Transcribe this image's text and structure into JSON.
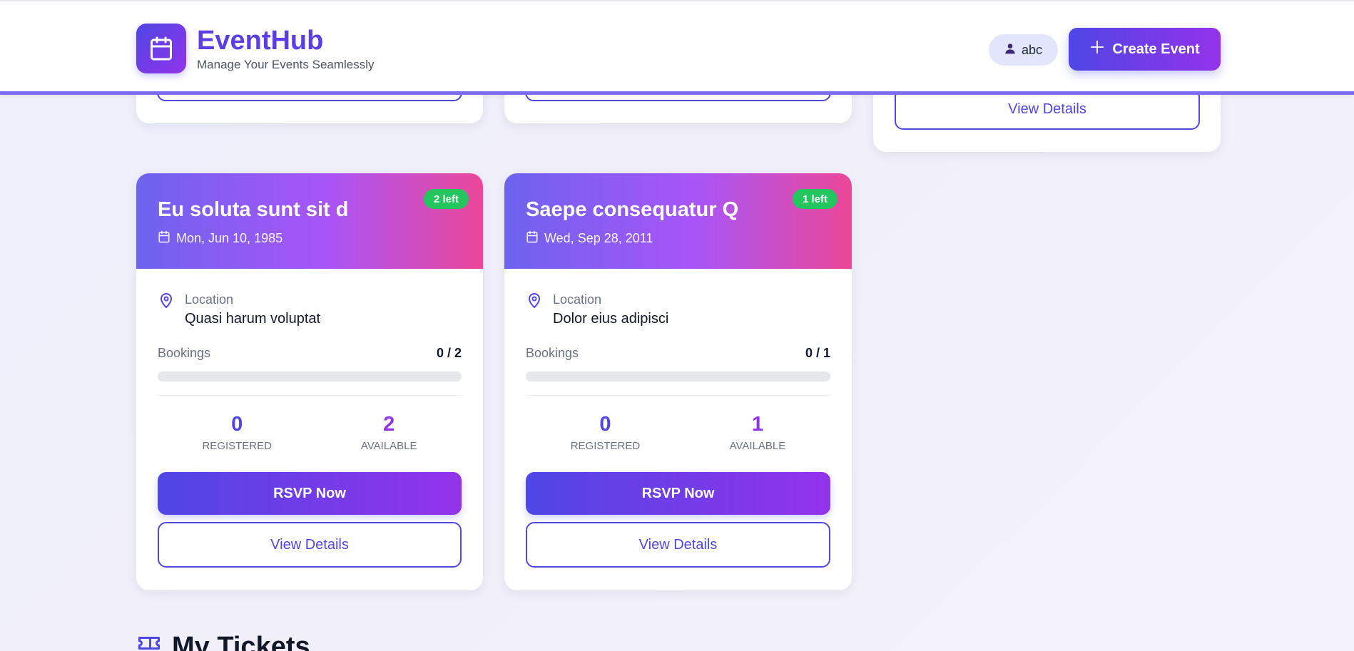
{
  "header": {
    "app_name": "EventHub",
    "tagline": "Manage Your Events Seamlessly",
    "user_name": "abc",
    "create_button": "Create Event"
  },
  "partial_cards": {
    "view_details_label": "View Details"
  },
  "events": [
    {
      "title": "Eu soluta sunt sit d",
      "date": "Mon, Jun 10, 1985",
      "seats_left": "2 left",
      "location_label": "Location",
      "location": "Quasi harum voluptat",
      "bookings_label": "Bookings",
      "bookings": "0 / 2",
      "booking_fill_fraction": 0,
      "registered": "0",
      "registered_label": "REGISTERED",
      "available": "2",
      "available_label": "AVAILABLE",
      "rsvp_label": "RSVP Now",
      "details_label": "View Details"
    },
    {
      "title": "Saepe consequatur Q",
      "date": "Wed, Sep 28, 2011",
      "seats_left": "1 left",
      "location_label": "Location",
      "location": "Dolor eius adipisci",
      "bookings_label": "Bookings",
      "bookings": "0 / 1",
      "booking_fill_fraction": 0,
      "registered": "0",
      "registered_label": "REGISTERED",
      "available": "1",
      "available_label": "AVAILABLE",
      "rsvp_label": "RSVP Now",
      "details_label": "View Details"
    }
  ],
  "tickets_section": {
    "title": "My Tickets"
  },
  "colors": {
    "primary": "#4f46e5",
    "accent": "#9333ea",
    "badge_green": "#22c55e"
  }
}
